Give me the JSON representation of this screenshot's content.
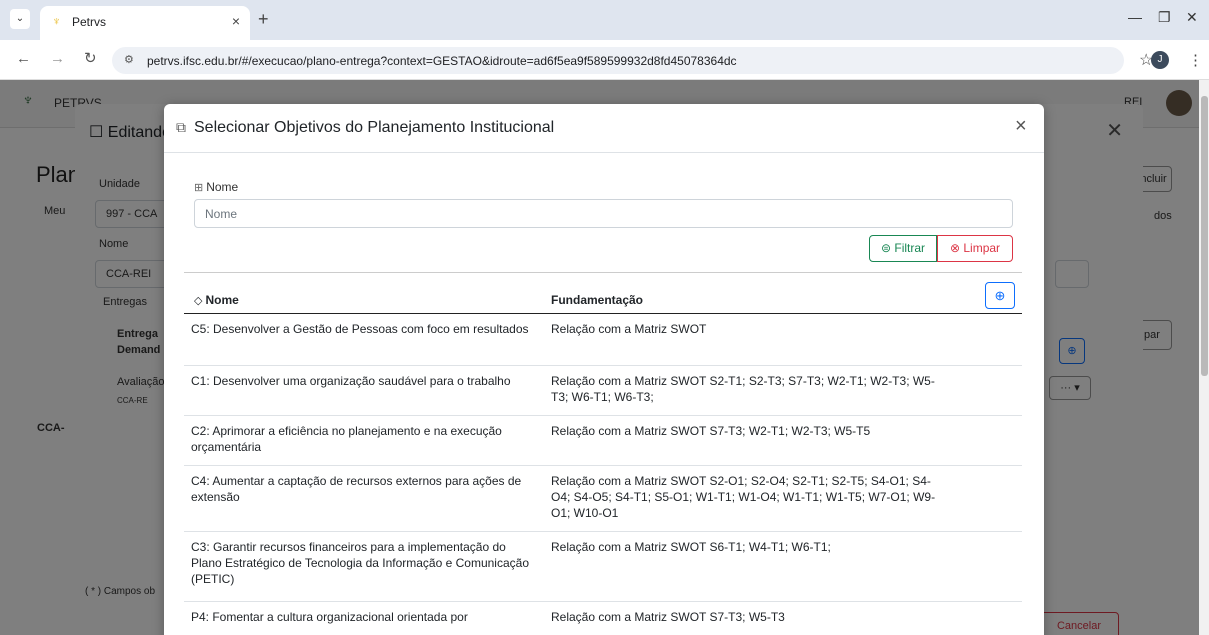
{
  "browser": {
    "tab_title": "Petrvs",
    "tab_close": "×",
    "new_tab": "+",
    "url": "petrvs.ifsc.edu.br/#/execucao/plano-entrega?context=GESTAO&idroute=ad6f5ea9f589599932d8fd45078364dc",
    "profile_initial": "J"
  },
  "background": {
    "app_name": "PETRVS",
    "user": "REI",
    "page_title": "Plan",
    "back_modal_title": "Editando",
    "labels": {
      "unidade": "Unidade",
      "unidade_value": "997 - CCA",
      "nome": "Nome",
      "nome_value": "CCA-REI",
      "entregas": "Entregas",
      "entrega_col": "Entrega",
      "demand_col": "Demand",
      "avaliacao": "Avaliação",
      "cca_tag": "CCA-RE",
      "cca_row": "CCA-",
      "campos": "( * ) Campos ob",
      "meu": "Meu",
      "incluir": "Incluir",
      "date_frag": "025",
      "todos": "dos",
      "par": "par",
      "cancelar": "Cancelar"
    }
  },
  "modal": {
    "title": "Selecionar Objetivos do Planejamento Institucional",
    "close": "×",
    "filter": {
      "label": "Nome",
      "placeholder": "Nome",
      "filter_button": "Filtrar",
      "clear_button": "Limpar"
    },
    "table": {
      "headers": {
        "nome": "Nome",
        "fundamentacao": "Fundamentação"
      },
      "add_button": "⊕",
      "rows": [
        {
          "nome": "C5: Desenvolver a Gestão de Pessoas com foco em resultados",
          "fundamentacao": "Relação com a Matriz SWOT"
        },
        {
          "nome": "C1: Desenvolver uma organização saudável para o trabalho",
          "fundamentacao": "Relação com a Matriz SWOT S2-T1; S2-T3; S7-T3; W2-T1; W2-T3; W5-T3; W6-T1; W6-T3;"
        },
        {
          "nome": "C2: Aprimorar a eficiência no planejamento e na execução orçamentária",
          "fundamentacao": "Relação com a Matriz SWOT S7-T3; W2-T1; W2-T3; W5-T5"
        },
        {
          "nome": "C4: Aumentar a captação de recursos externos para ações de extensão",
          "fundamentacao": "Relação com a Matriz SWOT S2-O1; S2-O4; S2-T1; S2-T5; S4-O1; S4-O4; S4-O5; S4-T1; S5-O1; W1-T1; W1-O4; W1-T1; W1-T5; W7-O1; W9-O1; W10-O1"
        },
        {
          "nome": "C3: Garantir recursos financeiros para a implementação do Plano Estratégico de Tecnologia da Informação e Comunicação (PETIC)",
          "fundamentacao": "Relação com a Matriz SWOT S6-T1; W4-T1; W6-T1;"
        },
        {
          "nome": "P4: Fomentar a cultura organizacional orientada por",
          "fundamentacao": "Relação com a Matriz SWOT S7-T3; W5-T3"
        }
      ]
    }
  }
}
